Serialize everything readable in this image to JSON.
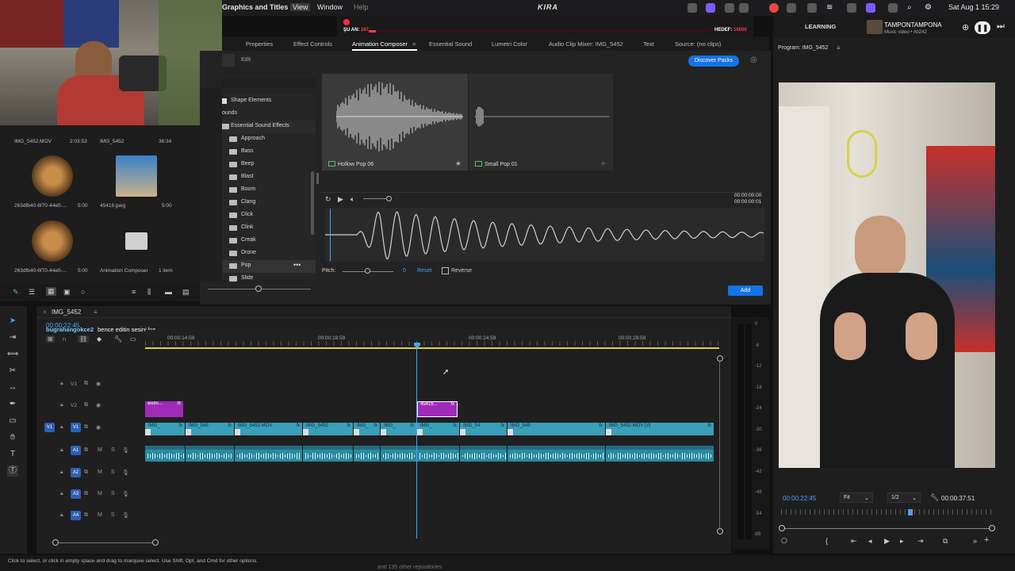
{
  "menubar": {
    "items": [
      "Graphics and Titles",
      "View",
      "Window",
      "Help"
    ],
    "center_brand": "KIRA",
    "rec_left_label": "ŞU AN:",
    "rec_left_value": "287",
    "rec_right_label": "HEDEF:",
    "rec_right_value": "15000",
    "clock": "Sat Aug 1  15:29",
    "workspace": "LEARNING",
    "now_playing_title": "TAMPONTAMPONA",
    "now_playing_sub": "Music video • Ati242"
  },
  "tabs": [
    "Properties",
    "Effect Controls",
    "Animation Composer",
    "Essential Sound",
    "Lumetri Color",
    "Audio Clip Mixer: IMG_5452",
    "Text",
    "Source: (no clips)"
  ],
  "program": {
    "title": "Program: IMG_5452",
    "timecode": "00:00:22:45",
    "fit": "Fit",
    "res": "1/2",
    "duration": "00:00:37:51"
  },
  "project": {
    "items": [
      {
        "name": "IMG_5452.MOV",
        "dur": "2:03:53"
      },
      {
        "name": "IMG_5452",
        "dur": "36:34"
      },
      {
        "name": "263dfb40-6f70-44e0-...",
        "dur": "5:00"
      },
      {
        "name": "45416.jpeg",
        "dur": "5:00"
      },
      {
        "name": "263dfb40-6f70-44e0-...",
        "dur": "5:00"
      },
      {
        "name": "Animation Composer",
        "dur": "1 item"
      }
    ]
  },
  "ac": {
    "edit": "Edit",
    "discover": "Discover Packs",
    "tree_header": "Shape Elements",
    "tree_sounds": "ounds",
    "tree_root": "Essential Sound Effects",
    "tree_items": [
      "Approach",
      "Bass",
      "Beep",
      "Blast",
      "Boom",
      "Clang",
      "Click",
      "Clink",
      "Creak",
      "Drone",
      "Pop",
      "Slide"
    ],
    "card1": "Hollow Pop 06",
    "card2": "Small Pop 01",
    "time_total": "00:00:00:00",
    "time_cur": "00:00:00:01",
    "pitch_label": "Pitch:",
    "pitch_value": "0",
    "reset": "Reset",
    "reverse": "Reverse",
    "add": "Add"
  },
  "timeline": {
    "tab": "IMG_5452",
    "timecode": "00:00:22:45",
    "caption_user": "bugrahangokce2",
    "caption_text": "bence editin sesini kıs",
    "ruler": [
      "00:00:14:59",
      "00:00:19:59",
      "00:00:24:59",
      "00:00:29:59"
    ],
    "tracks_v": [
      "V3",
      "V2",
      "V1"
    ],
    "tracks_a": [
      "A1",
      "A2",
      "A3",
      "A4"
    ],
    "v2_clips": [
      "webs...",
      "45416..."
    ],
    "v1_clips": [
      "IMG_",
      "IMG_545",
      "IMG_5452.MOV",
      "IMG_5452",
      "IMG_",
      "IMG_",
      "IMG_",
      "IMG_54",
      "IMG_545",
      "IMG_5452.MOV [V]"
    ],
    "meter_ticks": [
      "0",
      "-6",
      "-12",
      "-18",
      "-24",
      "-30",
      "-36",
      "-42",
      "-48",
      "-54",
      "dB"
    ]
  },
  "status": {
    "hint": "Click to select, or click in empty space and drag to marquee select. Use Shift, Opt, and Cmd for other options.",
    "bottom_text": "and 135 other repositories"
  },
  "colors": {
    "accent": "#1473e6",
    "clip_video": "#3a9fb8",
    "clip_audio": "#2b8aa0",
    "clip_graphic": "#9f2ab8",
    "playhead": "#4aa0ff"
  }
}
